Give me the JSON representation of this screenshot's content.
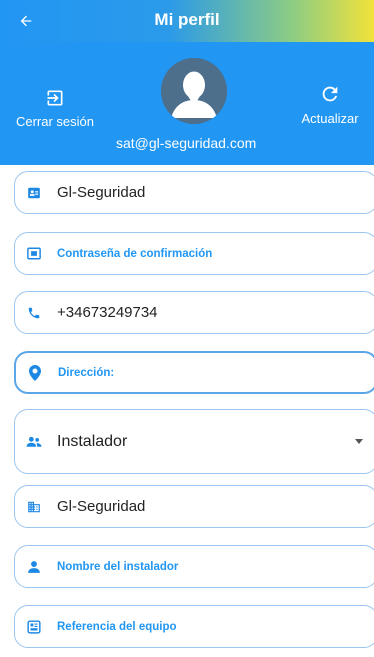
{
  "topbar": {
    "title": "Mi perfil"
  },
  "header": {
    "logout_label": "Cerrar sesión",
    "refresh_label": "Actualizar",
    "email": "sat@gl-seguridad.com"
  },
  "form": {
    "company": {
      "value": "Gl-Seguridad",
      "icon": "badge-icon"
    },
    "confirm_password": {
      "placeholder": "Contraseña de confirmación",
      "icon": "password-icon"
    },
    "phone": {
      "value": "+34673249734",
      "icon": "phone-icon"
    },
    "address": {
      "placeholder": "Dirección:",
      "icon": "location-pin-icon"
    },
    "role": {
      "value": "Instalador",
      "icon": "group-icon"
    },
    "business": {
      "value": "Gl-Seguridad",
      "icon": "business-icon"
    },
    "installer_name": {
      "placeholder": "Nombre del instalador",
      "icon": "person-icon"
    },
    "equipment_ref": {
      "placeholder": "Referencia del equipo",
      "icon": "equipment-icon"
    }
  },
  "colors": {
    "primary": "#2196f3",
    "gradient_end": "#f2e23a",
    "field_border": "#9cc6ee"
  }
}
